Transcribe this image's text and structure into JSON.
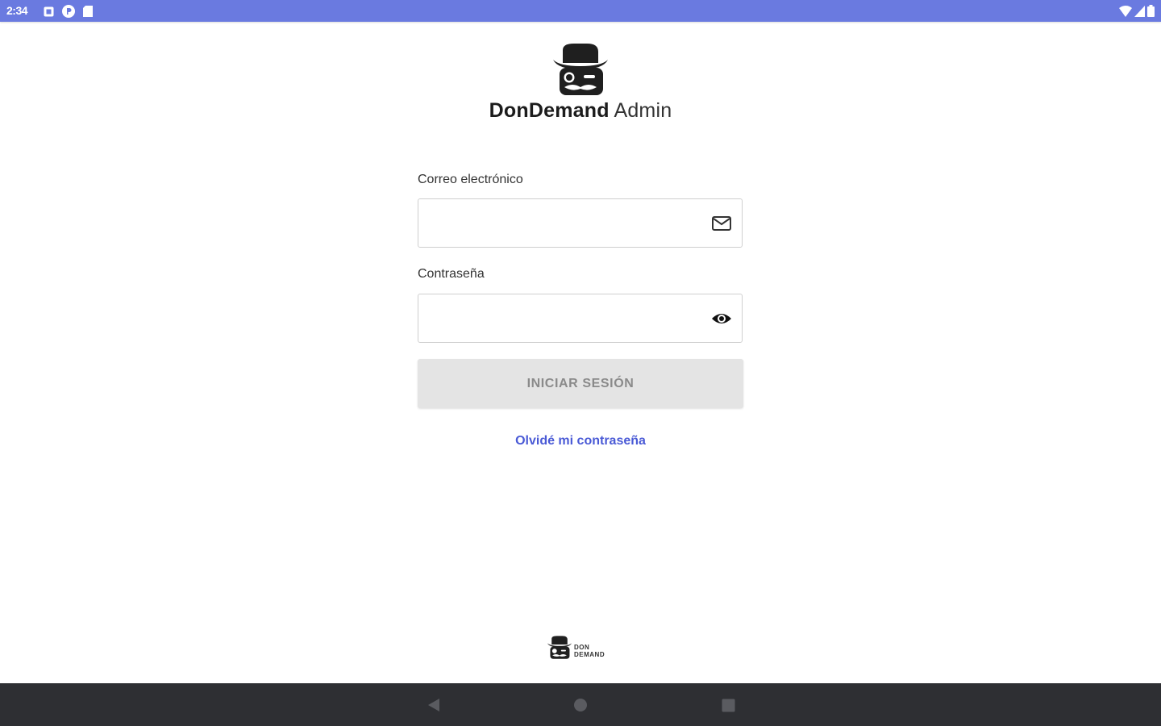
{
  "status_bar": {
    "time": "2:34",
    "left_icons": [
      "notification-square-icon",
      "circle-badge-icon",
      "sd-card-icon"
    ],
    "right_icons": [
      "wifi-icon",
      "cell-signal-icon",
      "battery-icon"
    ],
    "color": "#6a7ae0"
  },
  "brand": {
    "logo_icon": "don-mascot-icon",
    "title_strong": "DonDemand",
    "title_light": " Admin"
  },
  "login_form": {
    "email_label": "Correo electrónico",
    "email_value": "",
    "email_icon": "mail-icon",
    "password_label": "Contraseña",
    "password_value": "",
    "password_icon": "eye-icon",
    "submit_label": "INICIAR SESIÓN",
    "submit_enabled": false,
    "forgot_password_label": "Olvidé mi contraseña",
    "link_color": "#4a5ad6"
  },
  "footer": {
    "logo_icon": "don-mascot-icon",
    "logo_line1": "DON",
    "logo_line2": "DEMAND"
  },
  "nav_bar": {
    "buttons": [
      "back-icon",
      "home-icon",
      "recents-icon"
    ],
    "color": "#2e2f33"
  }
}
